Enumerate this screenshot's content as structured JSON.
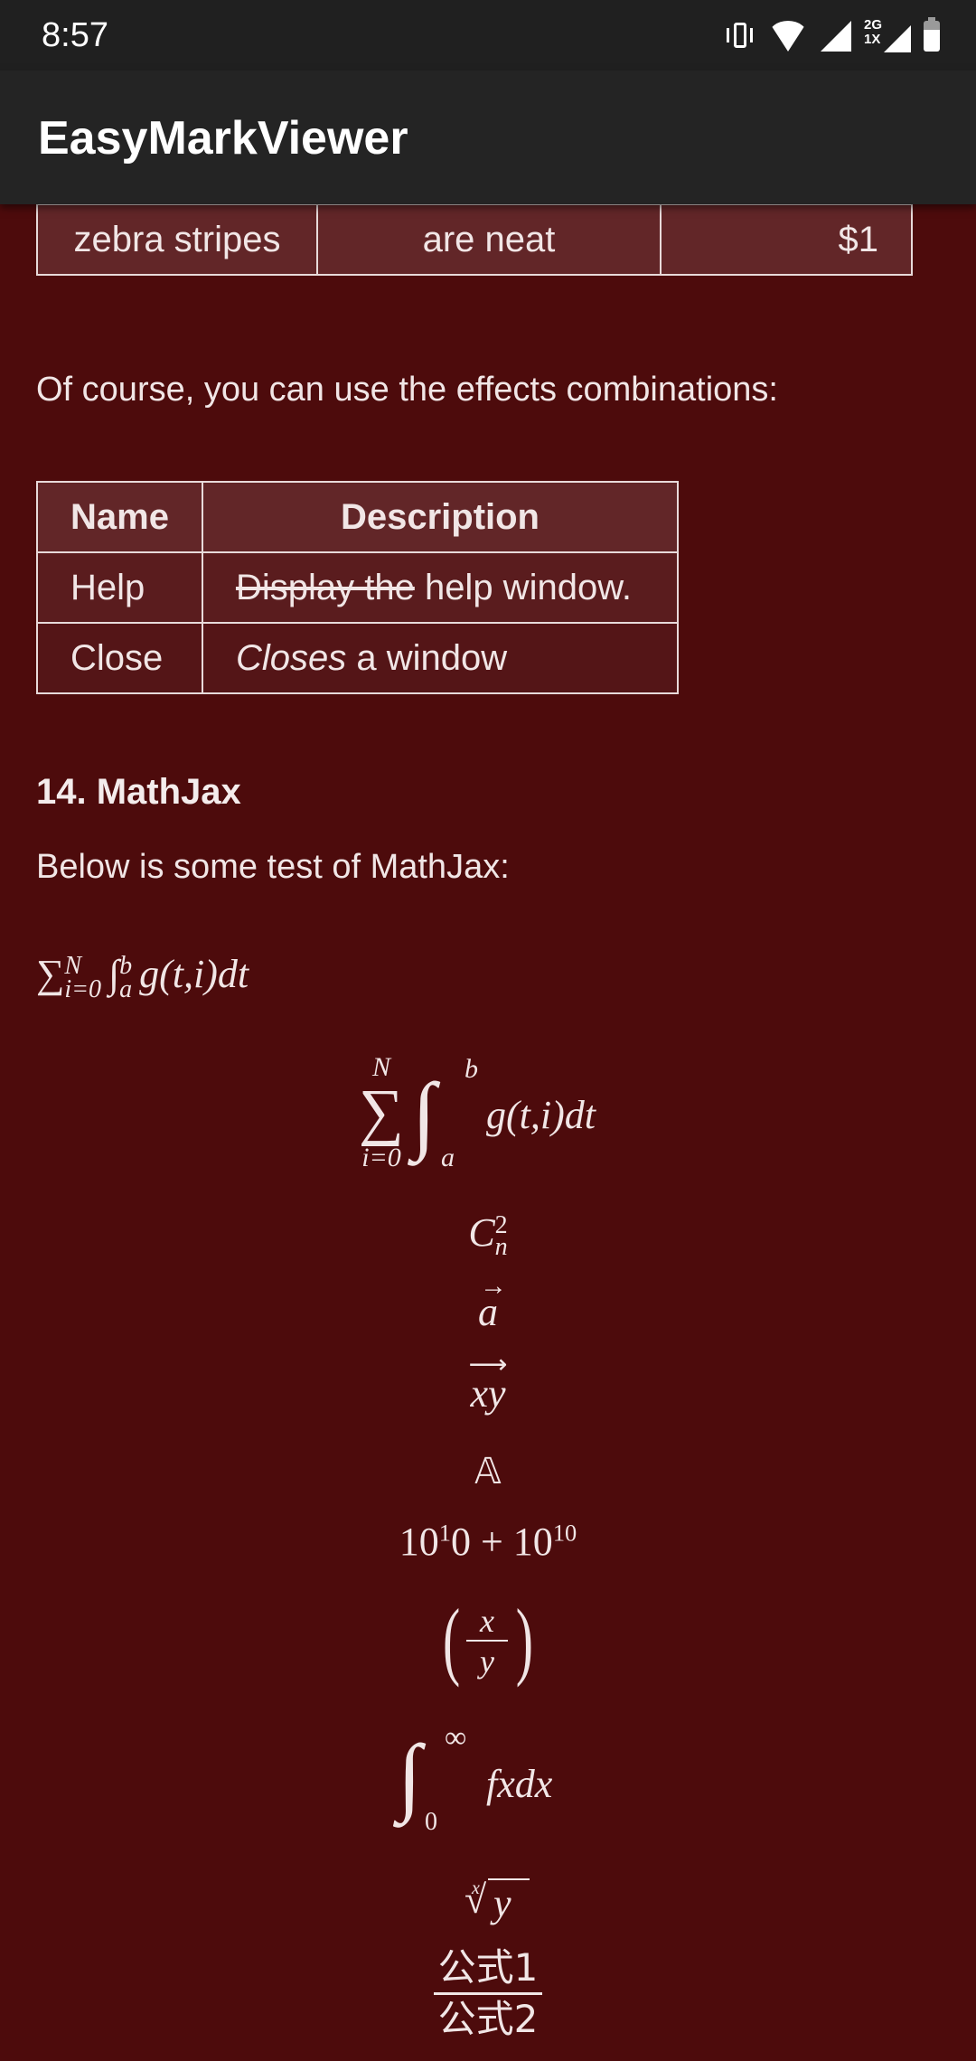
{
  "status_bar": {
    "time": "8:57",
    "network_label": "2G\n1X",
    "icons": [
      "vibrate-icon",
      "wifi-icon",
      "signal-icon",
      "2g-signal-icon",
      "battery-icon"
    ]
  },
  "app_bar": {
    "title": "EasyMarkViewer"
  },
  "table1": {
    "rows": [
      {
        "col1": "zebra stripes",
        "col2": "are neat",
        "col3": "$1"
      }
    ]
  },
  "text": {
    "combos_intro": "Of course, you can use the effects combinations:",
    "mathjax_heading": "14. MathJax",
    "mathjax_intro": "Below is some test of MathJax:"
  },
  "table2": {
    "headers": [
      "Name",
      "Description"
    ],
    "rows": [
      {
        "name": "Help",
        "desc_strike": "Display the",
        "desc_rest": " help window."
      },
      {
        "name": "Close",
        "desc_italic": "Closes",
        "desc_rest": " a window"
      }
    ]
  },
  "math": {
    "inline_sum": {
      "sigma": "∑",
      "sub": "i=0",
      "sup": "N",
      "int": "∫",
      "int_sub": "a",
      "int_sup": "b",
      "body": "g(t,i)dt"
    },
    "display_sum": {
      "sigma": "∑",
      "sub": "i=0",
      "sup": "N",
      "int": "∫",
      "int_sub": "a",
      "int_sup": "b",
      "body": "g(t,i)dt"
    },
    "binom": {
      "base": "C",
      "sub": "n",
      "sup": "2"
    },
    "vec_a": "a",
    "vec_xy": "xy",
    "double_struck": "𝔸",
    "powers": {
      "a": "10",
      "a_sup": "1",
      "mid": "0 + 10",
      "b_sup": "10"
    },
    "fraction": {
      "num": "x",
      "den": "y"
    },
    "integral": {
      "sub": "0",
      "sup": "∞",
      "body": "fxdx"
    },
    "root": {
      "index": "x",
      "radicand": "y"
    },
    "cjk_fraction": {
      "num": "公式1",
      "den": "公式2"
    }
  }
}
